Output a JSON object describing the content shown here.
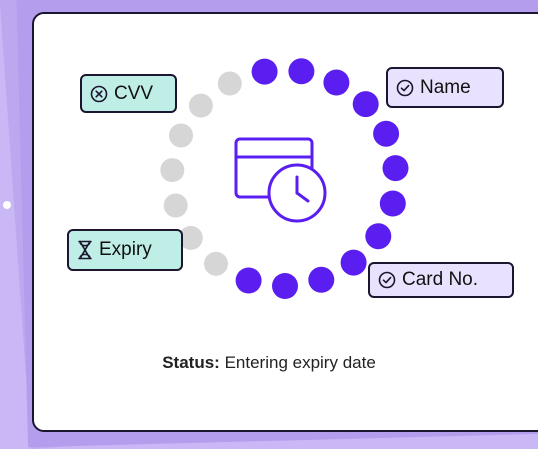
{
  "tags": {
    "cvv": {
      "label": "CVV",
      "icon": "x-circle-icon"
    },
    "name": {
      "label": "Name",
      "icon": "check-circle-icon"
    },
    "expiry": {
      "label": "Expiry",
      "icon": "hourglass-icon"
    },
    "card_no": {
      "label": "Card No.",
      "icon": "check-circle-icon"
    }
  },
  "status": {
    "label": "Status:",
    "text": "Entering expiry date"
  },
  "progress": {
    "completed_fraction": 0.63
  },
  "colors": {
    "accent": "#5a1ff0",
    "inactive_dot": "#d6d6d6",
    "teal_tag": "#bfeee6",
    "lavender_tag": "#e8e2ff",
    "background": "#c9b8f5"
  },
  "center_icon": "card-clock-icon"
}
